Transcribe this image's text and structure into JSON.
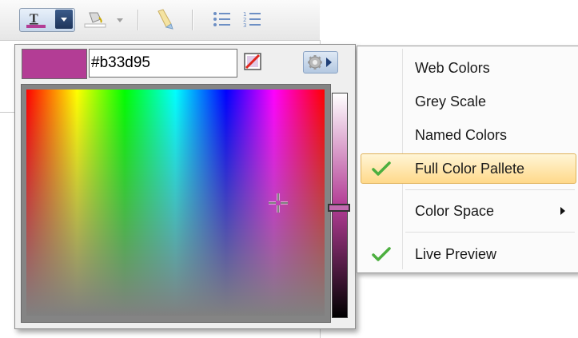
{
  "toolbar": {
    "buttons": [
      {
        "icon": "text-color-icon",
        "active": true
      },
      {
        "icon": "fill-color-icon",
        "active": false
      },
      {
        "icon": "highlighter-icon",
        "active": false
      },
      {
        "icon": "bulleted-list-icon",
        "active": false
      },
      {
        "icon": "numbered-list-icon",
        "active": false
      }
    ],
    "text_color_underline": "#b33d95"
  },
  "picker": {
    "current_color": "#b33d95",
    "hex_value": "#b33d95",
    "no_color_icon": "no-color-icon",
    "options_icon": "gear-icon"
  },
  "menu": {
    "items": [
      {
        "label": "Web Colors",
        "checked": false,
        "highlighted": false
      },
      {
        "label": "Grey Scale",
        "checked": false,
        "highlighted": false
      },
      {
        "label": "Named Colors",
        "checked": false,
        "highlighted": false
      },
      {
        "label": "Full Color Pallete",
        "checked": true,
        "highlighted": true
      },
      {
        "label": "Color Space",
        "checked": false,
        "highlighted": false,
        "submenu": true
      },
      {
        "label": "Live Preview",
        "checked": true,
        "highlighted": false
      }
    ]
  },
  "colors": {
    "accent": "#b33d95",
    "check_green": "#4caf3f",
    "highlight_fill": "#ffd98a"
  }
}
